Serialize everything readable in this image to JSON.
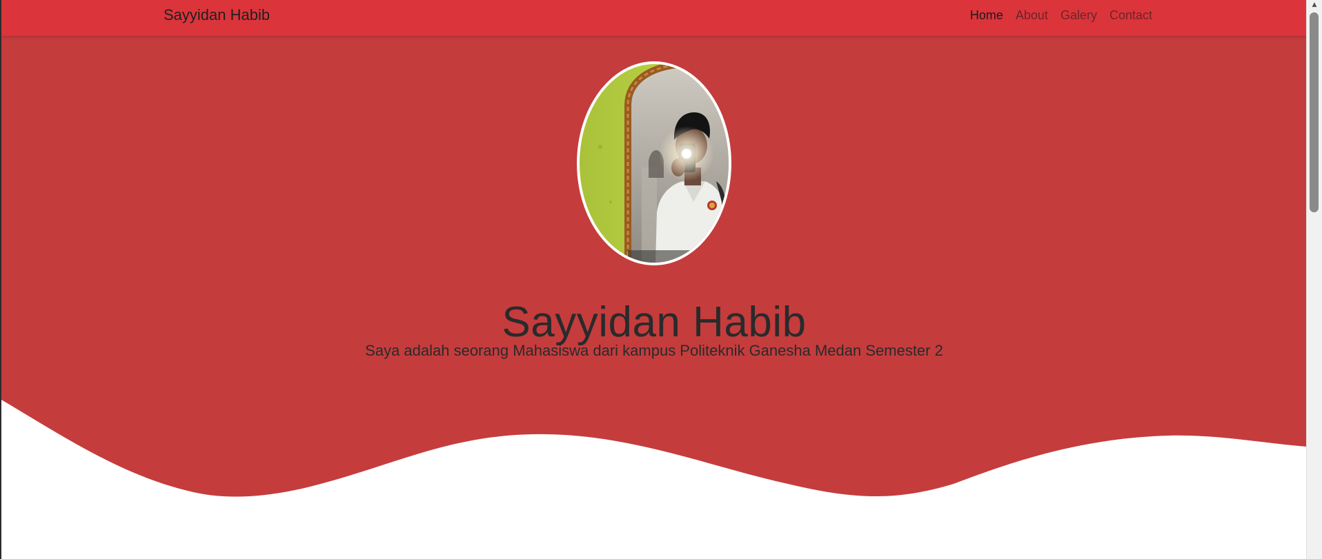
{
  "navbar": {
    "brand": "Sayyidan Habib",
    "background_color": "#dc343b",
    "links": [
      {
        "label": "Home",
        "active": true
      },
      {
        "label": "About",
        "active": false
      },
      {
        "label": "Galery",
        "active": false
      },
      {
        "label": "Contact",
        "active": false
      }
    ]
  },
  "hero": {
    "background_color": "#c53c3d",
    "profile_image": "selfie-photo",
    "title": "Sayyidan Habib",
    "subtitle": "Saya adalah seorang Mahasiswa dari kampus Politeknik Ganesha Medan Semester 2"
  },
  "scrollbar": {
    "up_icon": "arrow-up-icon"
  }
}
